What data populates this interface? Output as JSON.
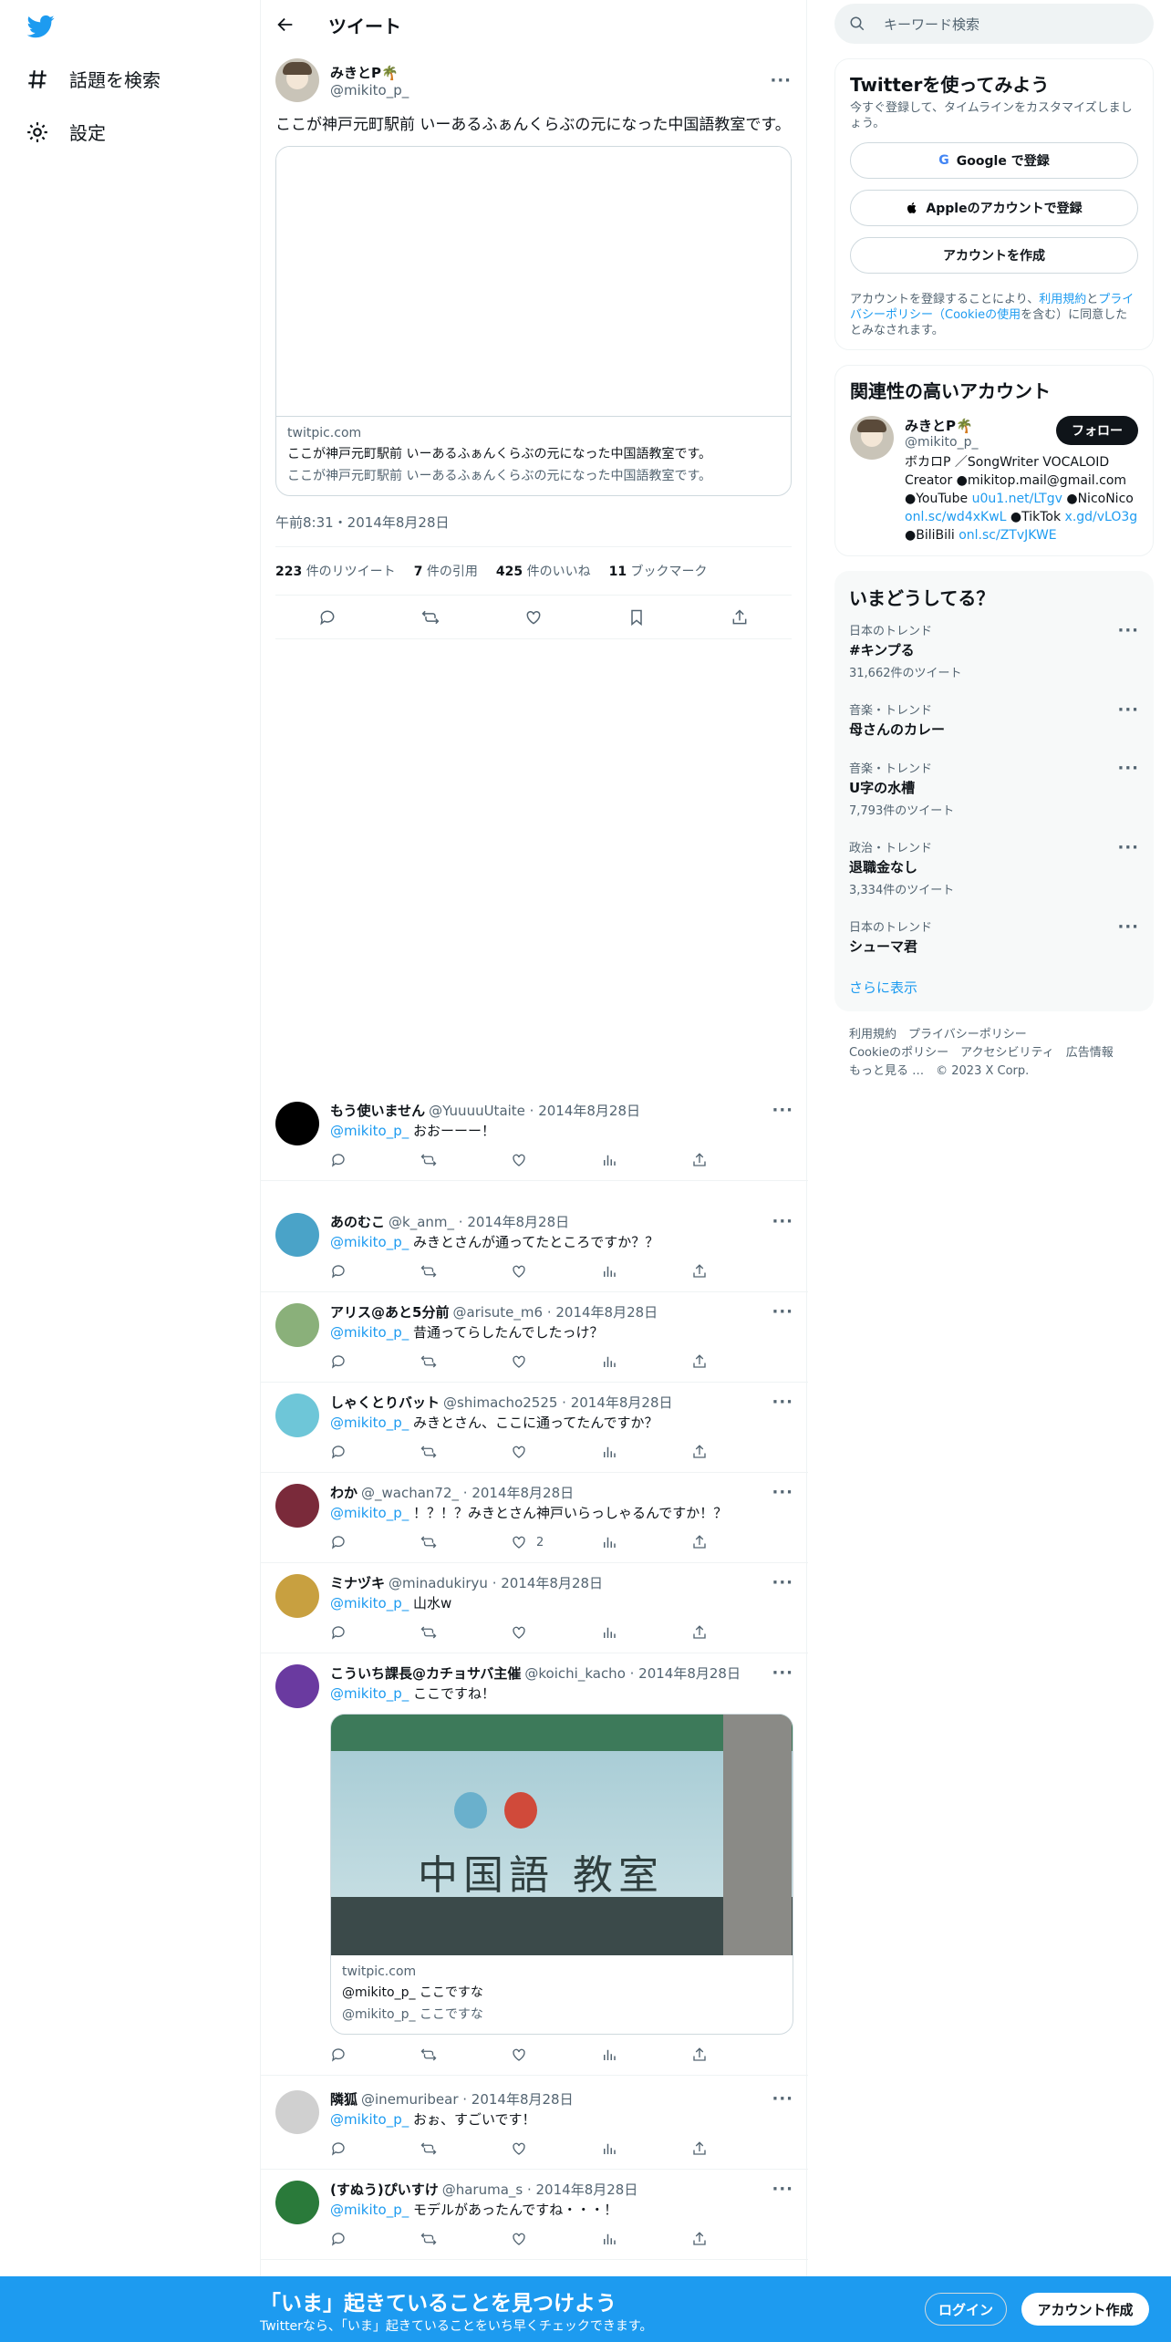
{
  "nav": {
    "explore_label": "話題を検索",
    "settings_label": "設定"
  },
  "header": {
    "title": "ツイート"
  },
  "tweet": {
    "name": "みきとP🌴",
    "handle": "@mikito_p_",
    "text": "ここが神戸元町駅前 いーあるふぁんくらぶの元になった中国語教室です。",
    "card": {
      "domain": "twitpic.com",
      "title": "ここが神戸元町駅前 いーあるふぁんくらぶの元になった中国語教室です。",
      "desc": "ここが神戸元町駅前 いーあるふぁんくらぶの元になった中国語教室です。"
    },
    "time": "午前8:31・2014年8月28日",
    "retweets": "223",
    "retweets_label": "件のリツイート",
    "quotes": "7",
    "quotes_label": "件の引用",
    "likes": "425",
    "likes_label": "件のいいね",
    "bookmarks": "11",
    "bookmarks_label": "ブックマーク"
  },
  "replies": [
    {
      "name": "もう使いません",
      "handle": "@YuuuuUtaite · 2014年8月28日",
      "mention": "@mikito_p_",
      "text": "おおーーー！",
      "likes": "",
      "avatar_color": "#000000"
    },
    {
      "name": "あのむこ",
      "handle": "@k_anm_ · 2014年8月28日",
      "mention": "@mikito_p_",
      "text": "みきとさんが通ってたところですか？？",
      "likes": "",
      "avatar_color": "#4aa3c8"
    },
    {
      "name": "アリス@あと5分前",
      "handle": "@arisute_m6 · 2014年8月28日",
      "mention": "@mikito_p_",
      "text": "昔通ってらしたんでしたっけ？",
      "likes": "",
      "avatar_color": "#8ab07a"
    },
    {
      "name": "しゃくとりバット",
      "handle": "@shimacho2525 · 2014年8月28日",
      "mention": "@mikito_p_",
      "text": "みきとさん、ここに通ってたんですか？",
      "likes": "",
      "avatar_color": "#6ec6d8"
    },
    {
      "name": "わか",
      "handle": "@_wachan72_ · 2014年8月28日",
      "mention": "@mikito_p_",
      "text": "！？！？みきとさん神戸いらっしゃるんですか！？",
      "likes": "2",
      "avatar_color": "#7a2a3a"
    },
    {
      "name": "ミナヅキ",
      "handle": "@minadukiryu · 2014年8月28日",
      "mention": "@mikito_p_",
      "text": "山水w",
      "likes": "",
      "avatar_color": "#c8a040"
    },
    {
      "name": "こういち課長@カチョサバ主催",
      "handle": "@koichi_kacho · 2014年8月28日",
      "mention": "@mikito_p_",
      "text": "ここですね！",
      "likes": "",
      "avatar_color": "#6a3aa0",
      "card": {
        "domain": "twitpic.com",
        "title": "@mikito_p_ ここですな",
        "desc": "@mikito_p_ ここですな",
        "sign": "中国語 教室"
      }
    },
    {
      "name": "隣狐",
      "handle": "@inemuribear · 2014年8月28日",
      "mention": "@mikito_p_",
      "text": "おぉ、すごいです！",
      "likes": "",
      "avatar_color": "#d0d0d0"
    },
    {
      "name": "(すぬう)ぴいすけ",
      "handle": "@haruma_s · 2014年8月28日",
      "mention": "@mikito_p_",
      "text": "モデルがあったんですね・・・！",
      "likes": "",
      "avatar_color": "#2a7a3a"
    }
  ],
  "search": {
    "placeholder": "キーワード検索"
  },
  "signup": {
    "title": "Twitterを使ってみよう",
    "sub": "今すぐ登録して、タイムラインをカスタマイズしましょう。",
    "google": "Google で登録",
    "apple": "Appleのアカウントで登録",
    "create": "アカウントを作成",
    "legal_1": "アカウントを登録することにより、",
    "terms": "利用規約",
    "legal_2": "と",
    "privacy": "プライバシーポリシー（Cookieの使用",
    "legal_3": "を含む）に同意したとみなされます。"
  },
  "relevant": {
    "title": "関連性の高いアカウント",
    "name": "みきとP🌴",
    "handle": "@mikito_p_",
    "follow": "フォロー",
    "bio_1": "ボカロP ／SongWriter VOCALOID Creator ●mikitop.mail@gmail.com ●YouTube ",
    "link_1": "u0u1.net/LTgv",
    "bio_2": " ●NicoNico ",
    "link_2": "onl.sc/wd4xKwL",
    "bio_3": " ●TikTok ",
    "link_3": "x.gd/vLO3g",
    "bio_4": " ●BiliBili ",
    "link_4": "onl.sc/ZTvJKWE"
  },
  "trends": {
    "title": "いまどうしてる？",
    "items": [
      {
        "cat": "日本のトレンド",
        "name": "#キンプる",
        "count": "31,662件のツイート"
      },
      {
        "cat": "音楽・トレンド",
        "name": "母さんのカレー",
        "count": ""
      },
      {
        "cat": "音楽・トレンド",
        "name": "U字の水槽",
        "count": "7,793件のツイート"
      },
      {
        "cat": "政治・トレンド",
        "name": "退職金なし",
        "count": "3,334件のツイート"
      },
      {
        "cat": "日本のトレンド",
        "name": "シューマ君",
        "count": ""
      }
    ],
    "show_more": "さらに表示"
  },
  "footer": {
    "line1": "利用規約　プライバシーポリシー",
    "line2": "Cookieのポリシー　アクセシビリティ　広告情報",
    "line3": "もっと見る …　© 2023 X Corp."
  },
  "banner": {
    "title": "「いま」起きていることを見つけよう",
    "sub": "Twitterなら、「いま」起きていることをいち早くチェックできます。",
    "login": "ログイン",
    "signup": "アカウント作成"
  },
  "colors": {
    "accent": "#1d9bf0",
    "banner": "#1d9bf0"
  }
}
